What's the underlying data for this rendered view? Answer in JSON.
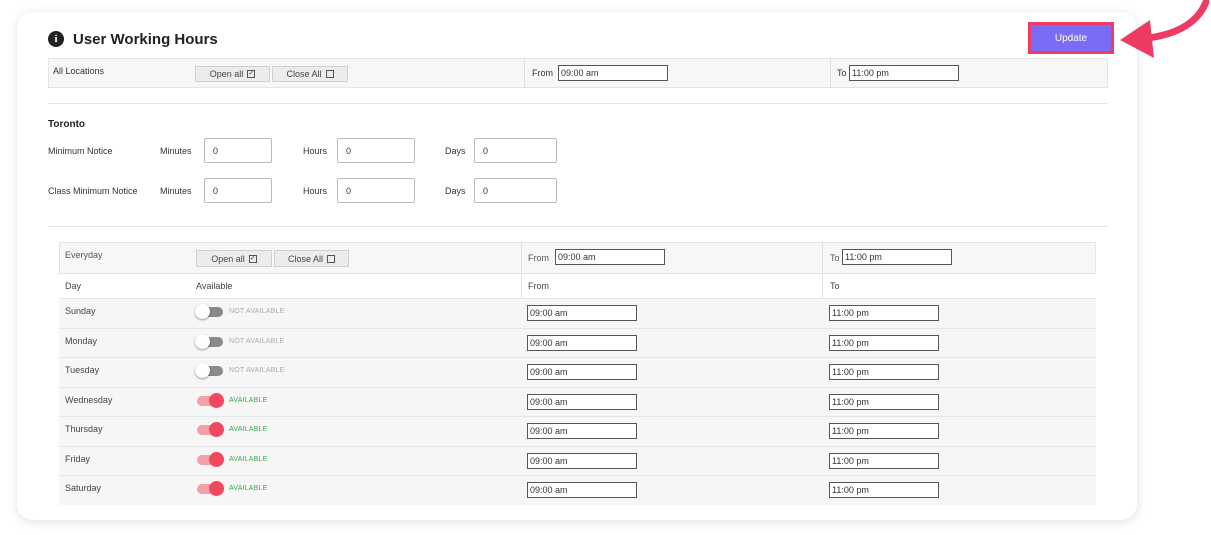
{
  "page_title": "User Working Hours",
  "update_label": "Update",
  "all_locations": {
    "label": "All Locations",
    "open_all_label": "Open all",
    "close_all_label": "Close All",
    "from_label": "From",
    "from_value": "09:00 am",
    "to_label": "To",
    "to_value": "11:00 pm"
  },
  "location": {
    "name": "Toronto",
    "minimum_notice": {
      "label": "Minimum Notice",
      "minutes_label": "Minutes",
      "minutes_value": "0",
      "hours_label": "Hours",
      "hours_value": "0",
      "days_label": "Days",
      "days_value": "0"
    },
    "class_minimum_notice": {
      "label": "Class Minimum Notice",
      "minutes_label": "Minutes",
      "minutes_value": "0",
      "hours_label": "Hours",
      "hours_value": "0",
      "days_label": "Days",
      "days_value": "0"
    }
  },
  "everyday": {
    "label": "Everyday",
    "open_all_label": "Open all",
    "close_all_label": "Close All",
    "from_label": "From",
    "from_value": "09:00 am",
    "to_label": "To",
    "to_value": "11:00 pm"
  },
  "table": {
    "headers": [
      "Day",
      "Available",
      "From",
      "To"
    ],
    "rows": [
      {
        "day": "Sunday",
        "available": false,
        "status": "NOT AVAILABLE",
        "from": "09:00 am",
        "to": "11:00 pm"
      },
      {
        "day": "Monday",
        "available": false,
        "status": "NOT AVAILABLE",
        "from": "09:00 am",
        "to": "11:00 pm"
      },
      {
        "day": "Tuesday",
        "available": false,
        "status": "NOT AVAILABLE",
        "from": "09:00 am",
        "to": "11:00 pm"
      },
      {
        "day": "Wednesday",
        "available": true,
        "status": "AVAILABLE",
        "from": "09:00 am",
        "to": "11:00 pm"
      },
      {
        "day": "Thursday",
        "available": true,
        "status": "AVAILABLE",
        "from": "09:00 am",
        "to": "11:00 pm"
      },
      {
        "day": "Friday",
        "available": true,
        "status": "AVAILABLE",
        "from": "09:00 am",
        "to": "11:00 pm"
      },
      {
        "day": "Saturday",
        "available": true,
        "status": "AVAILABLE",
        "from": "09:00 am",
        "to": "11:00 pm"
      }
    ]
  },
  "colors": {
    "accent": "#7b6cf6",
    "highlight": "#ee3b63",
    "toggle_on": "#f0485f",
    "available_text": "#3aa84a"
  },
  "icons": {
    "title": "info-icon",
    "callout": "curved-arrow-icon"
  }
}
